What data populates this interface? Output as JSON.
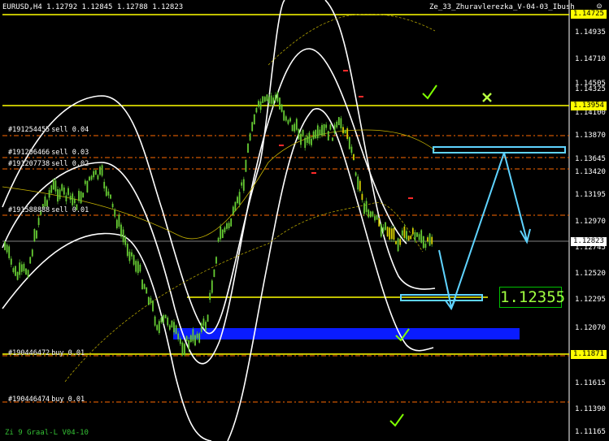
{
  "header": {
    "symbol_line": "EURUSD,H4  1.12792 1.12845 1.12788 1.12823",
    "indicator_name": "Ze_33_Zhuravlerezka_V-04-03_Ibush"
  },
  "footer": {
    "label": "Zi 9 Graal-L V04-10"
  },
  "price_axis": {
    "ticks": [
      "1.14935",
      "1.14710",
      "1.14505",
      "1.14325",
      "1.14100",
      "1.13870",
      "1.13645",
      "1.13420",
      "1.13195",
      "1.12970",
      "1.12745",
      "1.12520",
      "1.12295",
      "1.12070",
      "1.11845",
      "1.11615",
      "1.11390",
      "1.11165"
    ],
    "level_tags": {
      "top": "1.14725",
      "upper": "1.13954",
      "current": "1.12823",
      "lower": "1.11871"
    }
  },
  "target_label": "1.12355",
  "orders": [
    {
      "id": "#191254455",
      "text": "sell 0.04"
    },
    {
      "id": "#191206466",
      "text": "sell 0.03"
    },
    {
      "id": "#191207738",
      "text": "sell 0.02"
    },
    {
      "id": "#191588888",
      "text": "sell 0.01"
    },
    {
      "id": "#190446472",
      "text": "buy 0.01"
    },
    {
      "id": "#190446474",
      "text": "buy 0.01"
    }
  ],
  "colors": {
    "candles": "#66cc33",
    "level_line": "#ffff00",
    "bands": "#ffffff",
    "zone": "#0a1cff",
    "arrow": "#5fd3ff",
    "order_line": "#ff6a00",
    "check": "#7fff00"
  },
  "icons": [
    "smiley-icon",
    "check-icon",
    "cross-icon"
  ]
}
